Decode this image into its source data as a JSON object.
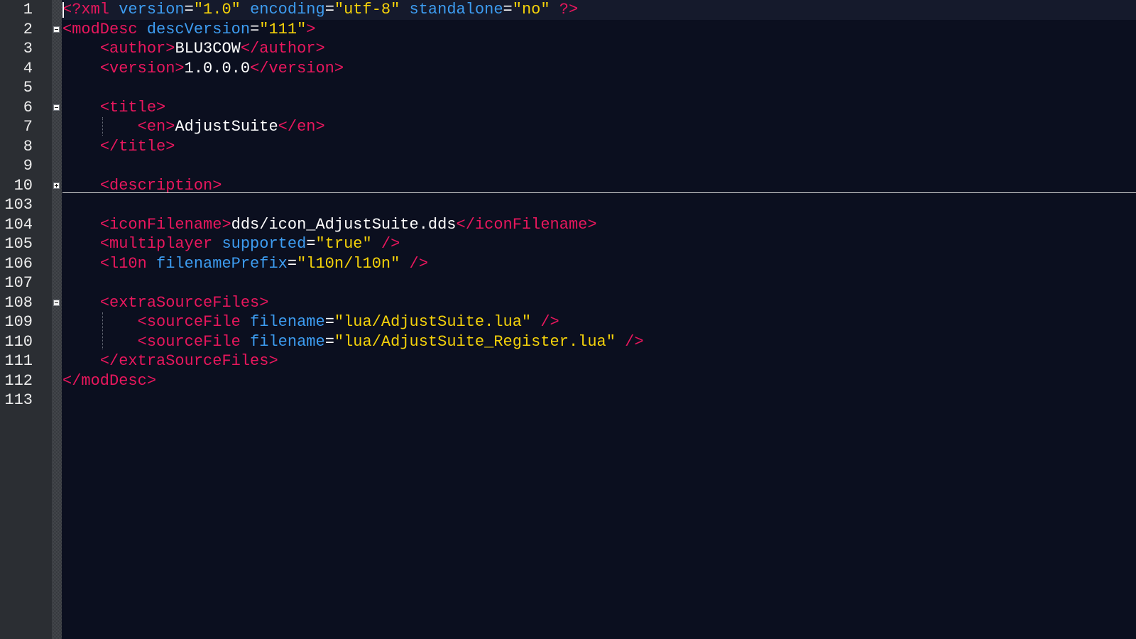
{
  "editor": {
    "lines": [
      {
        "n": "1",
        "tokens": [
          [
            "t",
            "<?"
          ],
          [
            "t",
            "xml"
          ],
          [
            "x",
            " "
          ],
          [
            "a",
            "version"
          ],
          [
            "e",
            "="
          ],
          [
            "s",
            "\"1.0\""
          ],
          [
            "x",
            " "
          ],
          [
            "a",
            "encoding"
          ],
          [
            "e",
            "="
          ],
          [
            "s",
            "\"utf-8\""
          ],
          [
            "x",
            " "
          ],
          [
            "a",
            "standalone"
          ],
          [
            "e",
            "="
          ],
          [
            "s",
            "\"no\""
          ],
          [
            "x",
            " "
          ],
          [
            "t",
            "?>"
          ]
        ]
      },
      {
        "n": "2",
        "fold": "minus",
        "tokens": [
          [
            "t",
            "<modDesc"
          ],
          [
            "x",
            " "
          ],
          [
            "a",
            "descVersion"
          ],
          [
            "e",
            "="
          ],
          [
            "s",
            "\"111\""
          ],
          [
            "t",
            ">"
          ]
        ]
      },
      {
        "n": "3",
        "tokens": [
          [
            "x",
            "    "
          ],
          [
            "t",
            "<author>"
          ],
          [
            "x",
            "BLU3COW"
          ],
          [
            "t",
            "</author>"
          ]
        ]
      },
      {
        "n": "4",
        "tokens": [
          [
            "x",
            "    "
          ],
          [
            "t",
            "<version>"
          ],
          [
            "x",
            "1.0.0.0"
          ],
          [
            "t",
            "</version>"
          ]
        ]
      },
      {
        "n": "5",
        "tokens": []
      },
      {
        "n": "6",
        "fold": "minus",
        "tokens": [
          [
            "x",
            "    "
          ],
          [
            "t",
            "<title>"
          ]
        ]
      },
      {
        "n": "7",
        "tokens": [
          [
            "x",
            "        "
          ],
          [
            "t",
            "<en>"
          ],
          [
            "x",
            "AdjustSuite"
          ],
          [
            "t",
            "</en>"
          ]
        ]
      },
      {
        "n": "8",
        "tokens": [
          [
            "x",
            "    "
          ],
          [
            "t",
            "</title>"
          ]
        ]
      },
      {
        "n": "9",
        "tokens": []
      },
      {
        "n": "10",
        "fold": "plus",
        "tokens": [
          [
            "x",
            "    "
          ],
          [
            "t",
            "<description>"
          ]
        ]
      },
      {
        "n": "103",
        "tokens": []
      },
      {
        "n": "104",
        "tokens": [
          [
            "x",
            "    "
          ],
          [
            "t",
            "<iconFilename>"
          ],
          [
            "x",
            "dds/icon_AdjustSuite.dds"
          ],
          [
            "t",
            "</iconFilename>"
          ]
        ]
      },
      {
        "n": "105",
        "tokens": [
          [
            "x",
            "    "
          ],
          [
            "t",
            "<multiplayer"
          ],
          [
            "x",
            " "
          ],
          [
            "a",
            "supported"
          ],
          [
            "e",
            "="
          ],
          [
            "s",
            "\"true\""
          ],
          [
            "x",
            " "
          ],
          [
            "t",
            "/>"
          ]
        ]
      },
      {
        "n": "106",
        "tokens": [
          [
            "x",
            "    "
          ],
          [
            "t",
            "<l10n"
          ],
          [
            "x",
            " "
          ],
          [
            "a",
            "filenamePrefix"
          ],
          [
            "e",
            "="
          ],
          [
            "s",
            "\"l10n/l10n\""
          ],
          [
            "x",
            " "
          ],
          [
            "t",
            "/>"
          ]
        ]
      },
      {
        "n": "107",
        "tokens": []
      },
      {
        "n": "108",
        "fold": "minus",
        "tokens": [
          [
            "x",
            "    "
          ],
          [
            "t",
            "<extraSourceFiles>"
          ]
        ]
      },
      {
        "n": "109",
        "tokens": [
          [
            "x",
            "        "
          ],
          [
            "t",
            "<sourceFile"
          ],
          [
            "x",
            " "
          ],
          [
            "a",
            "filename"
          ],
          [
            "e",
            "="
          ],
          [
            "s",
            "\"lua/AdjustSuite.lua\""
          ],
          [
            "x",
            " "
          ],
          [
            "t",
            "/>"
          ]
        ]
      },
      {
        "n": "110",
        "tokens": [
          [
            "x",
            "        "
          ],
          [
            "t",
            "<sourceFile"
          ],
          [
            "x",
            " "
          ],
          [
            "a",
            "filename"
          ],
          [
            "e",
            "="
          ],
          [
            "s",
            "\"lua/AdjustSuite_Register.lua\""
          ],
          [
            "x",
            " "
          ],
          [
            "t",
            "/>"
          ]
        ]
      },
      {
        "n": "111",
        "tokens": [
          [
            "x",
            "    "
          ],
          [
            "t",
            "</extraSourceFiles>"
          ]
        ]
      },
      {
        "n": "112",
        "tokens": [
          [
            "t",
            "</modDesc>"
          ]
        ]
      },
      {
        "n": "113",
        "tokens": []
      }
    ]
  },
  "colors": {
    "background": "#0b0f1f",
    "gutter": "#2b2e33",
    "tag": "#e8175d",
    "attribute": "#3d9cf0",
    "string": "#f5d20a",
    "text": "#ffffff"
  }
}
